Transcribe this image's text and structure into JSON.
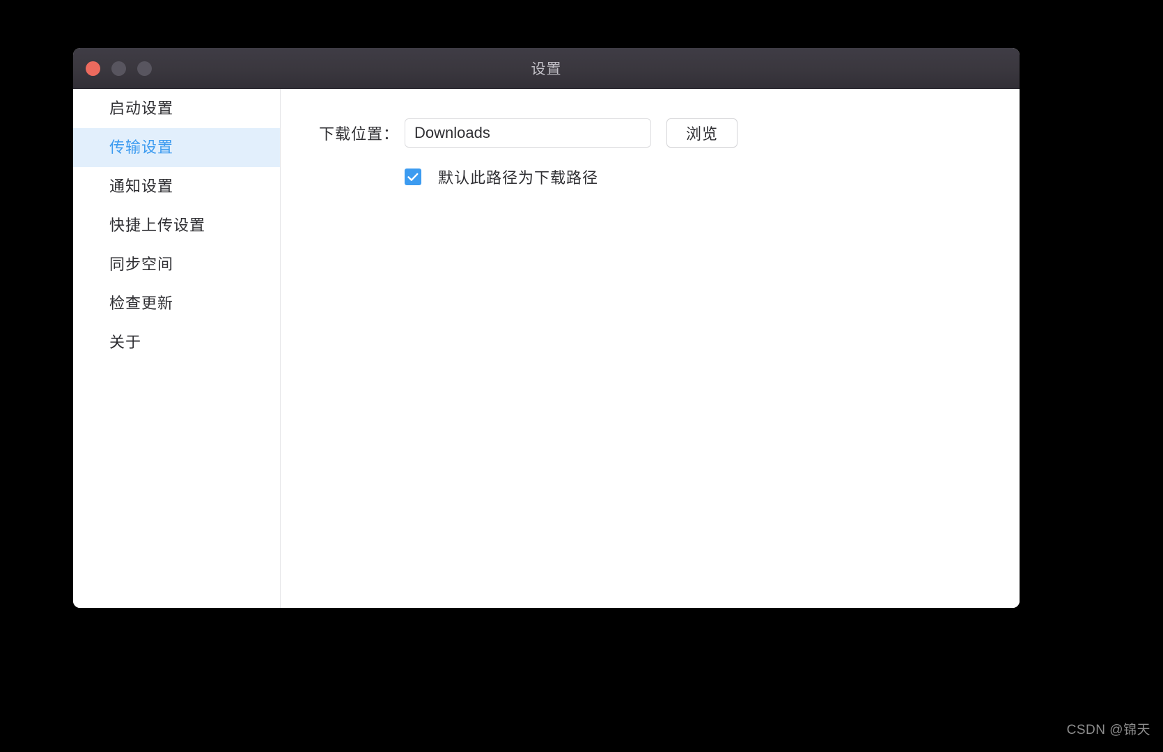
{
  "window": {
    "title": "设置",
    "controls": {
      "close": "close-button",
      "minimize": "minimize-button",
      "maximize": "maximize-button"
    },
    "colors": {
      "titlebar_bg": "#3a373e",
      "close_red": "#ec6a5e",
      "control_gray": "#58555f",
      "title_text": "#bfbdc4",
      "accent_blue": "#3c9bf0",
      "active_item_bg": "#e2effc",
      "text": "#2f2f33",
      "border": "#dcdcdf"
    }
  },
  "sidebar": {
    "items": [
      {
        "label": "启动设置",
        "active": false
      },
      {
        "label": "传输设置",
        "active": true
      },
      {
        "label": "通知设置",
        "active": false
      },
      {
        "label": "快捷上传设置",
        "active": false
      },
      {
        "label": "同步空间",
        "active": false
      },
      {
        "label": "检查更新",
        "active": false
      },
      {
        "label": "关于",
        "active": false
      }
    ]
  },
  "content": {
    "download_location": {
      "label": "下载位置：",
      "value": "Downloads",
      "placeholder": "Downloads",
      "browse_button": "浏览"
    },
    "default_path_checkbox": {
      "label": "默认此路径为下载路径",
      "checked": true
    }
  },
  "watermark": {
    "text": "CSDN @锦天"
  }
}
